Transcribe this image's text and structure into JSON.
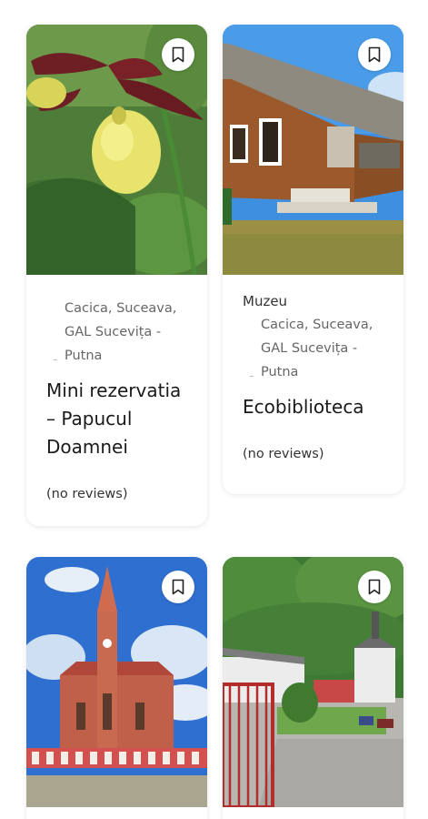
{
  "cards": [
    {
      "category": "",
      "location_lines": [
        "Cacica, Suceava,",
        "GAL Sucevița -",
        "Putna"
      ],
      "title": "Mini rezervatia – Papucul Doamnei",
      "reviews": "(no reviews)",
      "image": "orchid-flower",
      "bookmark_icon": "bookmark-icon"
    },
    {
      "category": "Muzeu",
      "location_lines": [
        "Cacica, Suceava,",
        "GAL Sucevița -",
        "Putna"
      ],
      "title": "Ecobiblioteca",
      "reviews": "(no reviews)",
      "image": "wooden-house",
      "bookmark_icon": "bookmark-icon"
    },
    {
      "image": "red-brick-church",
      "bookmark_icon": "bookmark-icon"
    },
    {
      "image": "monastery-gate",
      "bookmark_icon": "bookmark-icon"
    }
  ]
}
